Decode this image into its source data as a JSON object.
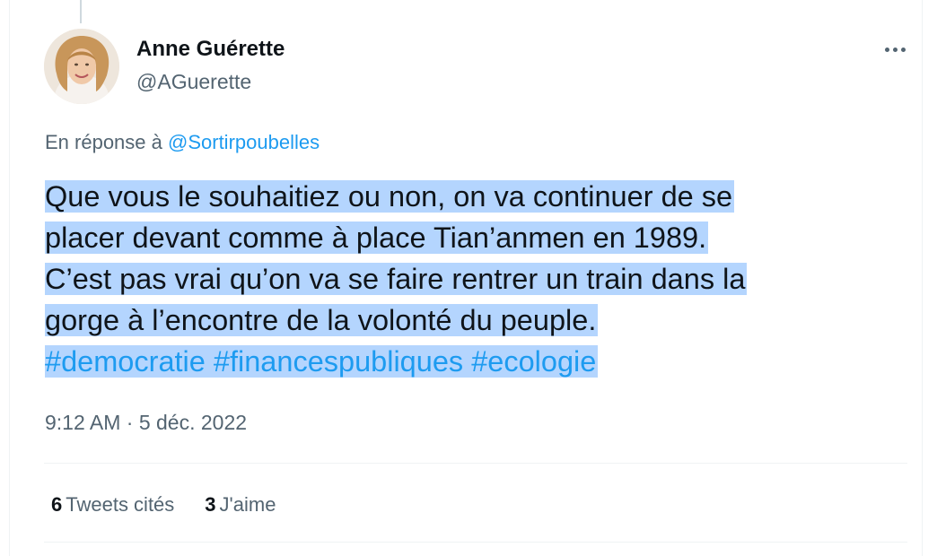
{
  "author": {
    "display_name": "Anne Guérette",
    "handle": "@AGuerette"
  },
  "reply": {
    "prefix": "En réponse à",
    "mention": "@Sortirpoubelles"
  },
  "tweet": {
    "lines": [
      "Que vous le souhaitiez ou non, on va continuer de se",
      "placer devant comme à place Tian’anmen en 1989.",
      "C’est pas vrai qu’on va se faire rentrer un train dans la",
      "gorge à l’encontre de la volonté du peuple."
    ],
    "hashtags": [
      "#democratie",
      "#financespubliques",
      "#ecologie"
    ]
  },
  "timestamp": "9:12 AM · 5 déc. 2022",
  "stats": {
    "quotes": {
      "count": "6",
      "label": "Tweets cités"
    },
    "likes": {
      "count": "3",
      "label": "J'aime"
    }
  },
  "icons": {
    "more": "more-options-icon"
  },
  "colors": {
    "link": "#1d9bf0",
    "text": "#0f1419",
    "secondary": "#536471",
    "selection": "#b4d5fe",
    "divider": "#eff3f4"
  }
}
